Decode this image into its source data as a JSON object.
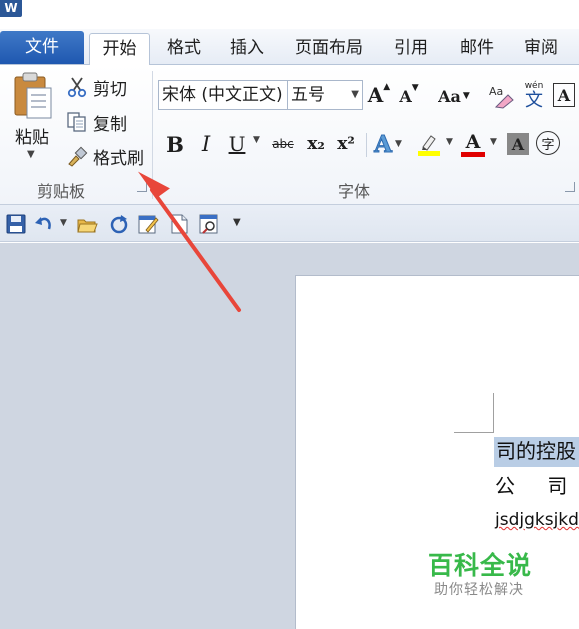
{
  "app": {
    "icon_text": "W"
  },
  "tabs": [
    {
      "label": "文件"
    },
    {
      "label": "开始"
    },
    {
      "label": "格式"
    },
    {
      "label": "插入"
    },
    {
      "label": "页面布局"
    },
    {
      "label": "引用"
    },
    {
      "label": "邮件"
    },
    {
      "label": "审阅"
    }
  ],
  "clipboard": {
    "paste_label": "粘贴",
    "cut_label": "剪切",
    "copy_label": "复制",
    "format_painter_label": "格式刷",
    "group_label": "剪贴板"
  },
  "font": {
    "name": "宋体 (中文正文)",
    "size": "五号",
    "group_label": "字体",
    "grow_label": "A",
    "shrink_label": "A",
    "change_case_label": "Aa",
    "char_border_label": "A",
    "bold_label": "B",
    "italic_label": "I",
    "underline_label": "U",
    "strike_label": "abc",
    "subscript_label": "x₂",
    "superscript_label": "x²",
    "text_effect_label": "A",
    "font_color_label": "A",
    "char_shading_label": "A",
    "enclose_label": "字",
    "phonetic_top": "wén",
    "phonetic_char": "文",
    "highlight_color": "#ffff00",
    "font_color": "#e00000"
  },
  "document": {
    "line1": "司的控股",
    "line2": "公 司",
    "line3": "jsdjgksjkd"
  },
  "watermark": {
    "title": "百科全说",
    "subtitle": "助你轻松解决"
  },
  "colors": {
    "arrow": "#e8463a",
    "file_tab": "#2b66bd",
    "selection": "#b9cde5"
  }
}
